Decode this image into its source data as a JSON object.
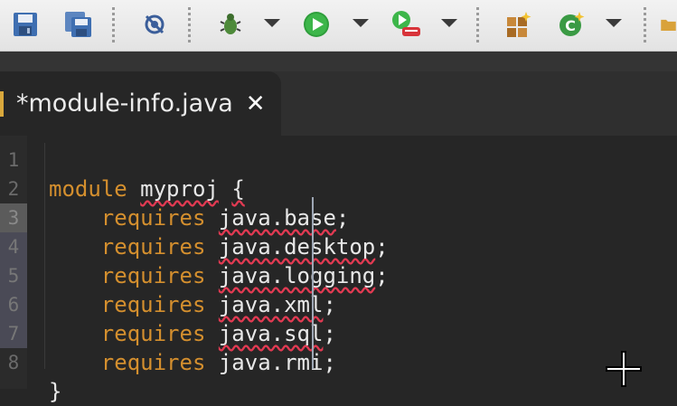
{
  "toolbar": {
    "items": [
      {
        "name": "save-icon"
      },
      {
        "name": "save-all-icon"
      },
      {
        "name": "skip-breakpoints-icon"
      },
      {
        "name": "debug-icon"
      },
      {
        "name": "run-icon"
      },
      {
        "name": "run-external-tool-icon"
      },
      {
        "name": "new-java-package-icon"
      },
      {
        "name": "new-java-class-icon"
      },
      {
        "name": "open-folder-icon"
      }
    ]
  },
  "editor": {
    "tab_title": "*module-info.java",
    "tab_close": "✕",
    "line_numbers": [
      "1",
      "2",
      "3",
      "4",
      "5",
      "6",
      "7",
      "8"
    ],
    "lines": [
      {
        "tokens": []
      },
      {
        "tokens": [
          {
            "t": "module",
            "k": "kw"
          },
          {
            "t": " "
          },
          {
            "t": "myproj",
            "sq": true
          },
          {
            "t": " "
          },
          {
            "t": "{",
            "sq": true
          }
        ]
      },
      {
        "tokens": [
          {
            "t": "    "
          },
          {
            "t": "requires",
            "k": "kw"
          },
          {
            "t": " "
          },
          {
            "t": "java.base",
            "sq": true
          },
          {
            "t": ";"
          }
        ]
      },
      {
        "tokens": [
          {
            "t": "    "
          },
          {
            "t": "requires",
            "k": "kw"
          },
          {
            "t": " "
          },
          {
            "t": "java.desktop",
            "sq": true
          },
          {
            "t": ";"
          }
        ]
      },
      {
        "tokens": [
          {
            "t": "    "
          },
          {
            "t": "requires",
            "k": "kw"
          },
          {
            "t": " "
          },
          {
            "t": "java.logging",
            "sq": true
          },
          {
            "t": ";"
          }
        ]
      },
      {
        "tokens": [
          {
            "t": "    "
          },
          {
            "t": "requires",
            "k": "kw"
          },
          {
            "t": " "
          },
          {
            "t": "java.xml",
            "sq": true
          },
          {
            "t": ";"
          }
        ]
      },
      {
        "tokens": [
          {
            "t": "    "
          },
          {
            "t": "requires",
            "k": "kw"
          },
          {
            "t": " "
          },
          {
            "t": "java.sql",
            "sq": true
          },
          {
            "t": ";"
          }
        ]
      },
      {
        "tokens": [
          {
            "t": "    "
          },
          {
            "t": "requires",
            "k": "kw"
          },
          {
            "t": " "
          },
          {
            "t": "java.rmi"
          },
          {
            "t": ";"
          }
        ]
      },
      {
        "tokens": [
          {
            "t": "}"
          }
        ]
      }
    ]
  },
  "colors": {
    "keyword": "#d48f2e",
    "text": "#e6e6e6",
    "editor_bg": "#262626",
    "error_underline": "#e23a52"
  }
}
